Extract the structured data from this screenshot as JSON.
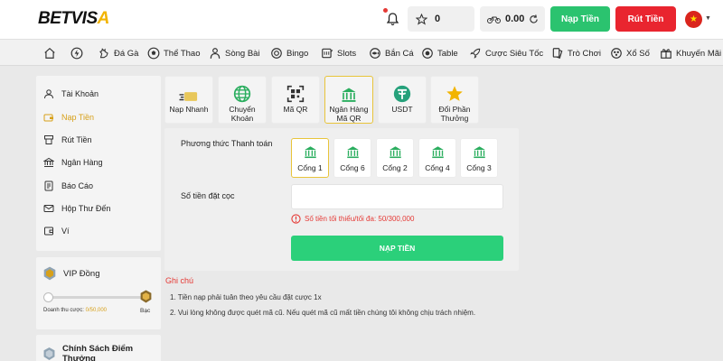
{
  "brand": {
    "logo_text_1": "BETVIS",
    "logo_text_2": "A"
  },
  "header": {
    "star_count": "0",
    "balance": "0.00",
    "deposit_label": "Nạp Tiền",
    "withdraw_label": "Rút Tiền",
    "accent_green": "#2bc36f",
    "accent_red": "#e9252f"
  },
  "nav": {
    "items": [
      {
        "label": "",
        "icon": "home-icon"
      },
      {
        "label": "",
        "icon": "lightning-icon"
      },
      {
        "label": "Đá Gà",
        "icon": "rooster-icon"
      },
      {
        "label": "Thể Thao",
        "icon": "soccer-ball-icon"
      },
      {
        "label": "Sòng Bài",
        "icon": "dealer-icon"
      },
      {
        "label": "Bingo",
        "icon": "bingo-icon"
      },
      {
        "label": "Slots",
        "icon": "slots-icon"
      },
      {
        "label": "Bắn Cá",
        "icon": "fish-icon"
      },
      {
        "label": "Table",
        "icon": "table-icon"
      },
      {
        "label": "Cược Siêu Tốc",
        "icon": "rocket-icon"
      },
      {
        "label": "Trò Chơi",
        "icon": "cards-icon"
      },
      {
        "label": "Xổ Số",
        "icon": "lottery-icon"
      },
      {
        "label": "Khuyến Mãi",
        "icon": "gift-icon"
      }
    ]
  },
  "sidebar": {
    "items": [
      {
        "label": "Tài Khoản",
        "icon": "user-icon",
        "active": false
      },
      {
        "label": "Nạp Tiền",
        "icon": "wallet-icon",
        "active": true
      },
      {
        "label": "Rút Tiền",
        "icon": "withdraw-icon",
        "active": false
      },
      {
        "label": "Ngân Hàng",
        "icon": "bank-icon",
        "active": false
      },
      {
        "label": "Báo Cáo",
        "icon": "report-icon",
        "active": false
      },
      {
        "label": "Hộp Thư Đến",
        "icon": "mail-icon",
        "active": false
      },
      {
        "label": "Ví",
        "icon": "wallet-outline-icon",
        "active": false
      }
    ],
    "vip": {
      "title": "VIP Đồng",
      "revenue_label": "Doanh thu cược:",
      "revenue_value": "0/50,000",
      "next_level": "Bạc",
      "progress": 0
    },
    "policy_title": "Chính Sách Điểm Thưởng"
  },
  "methods": [
    {
      "label": "Nạp Nhanh",
      "icon": "fast-pay-icon",
      "active": false
    },
    {
      "label": "Chuyển Khoản",
      "icon": "globe-icon",
      "active": false
    },
    {
      "label": "Mã QR",
      "icon": "qr-icon",
      "active": false
    },
    {
      "label": "Ngân Hàng Mã QR",
      "icon": "bank-qr-icon",
      "active": true
    },
    {
      "label": "USDT",
      "icon": "usdt-icon",
      "active": false
    },
    {
      "label": "Đổi Phần Thưởng",
      "icon": "star-icon",
      "active": false
    }
  ],
  "form": {
    "method_label": "Phương thức Thanh toán",
    "gates": [
      {
        "label": "Cổng 1",
        "active": true
      },
      {
        "label": "Cổng 6",
        "active": false
      },
      {
        "label": "Cổng 2",
        "active": false
      },
      {
        "label": "Cổng 4",
        "active": false
      },
      {
        "label": "Cổng 3",
        "active": false
      }
    ],
    "amount_label": "Số tiền đặt cọc",
    "amount_value": "",
    "limit_note": "Số tiền tối thiểu/tối đa: 50/300,000",
    "submit_label": "NẠP TIỀN"
  },
  "notes": {
    "title": "Ghi chú",
    "lines": [
      "1. Tiền nạp phải tuân theo yêu cầu đặt cược 1x",
      "2. Vui lòng không được quét mã cũ. Nếu quét mã cũ mất tiền chúng tôi không chịu trách nhiệm."
    ]
  }
}
